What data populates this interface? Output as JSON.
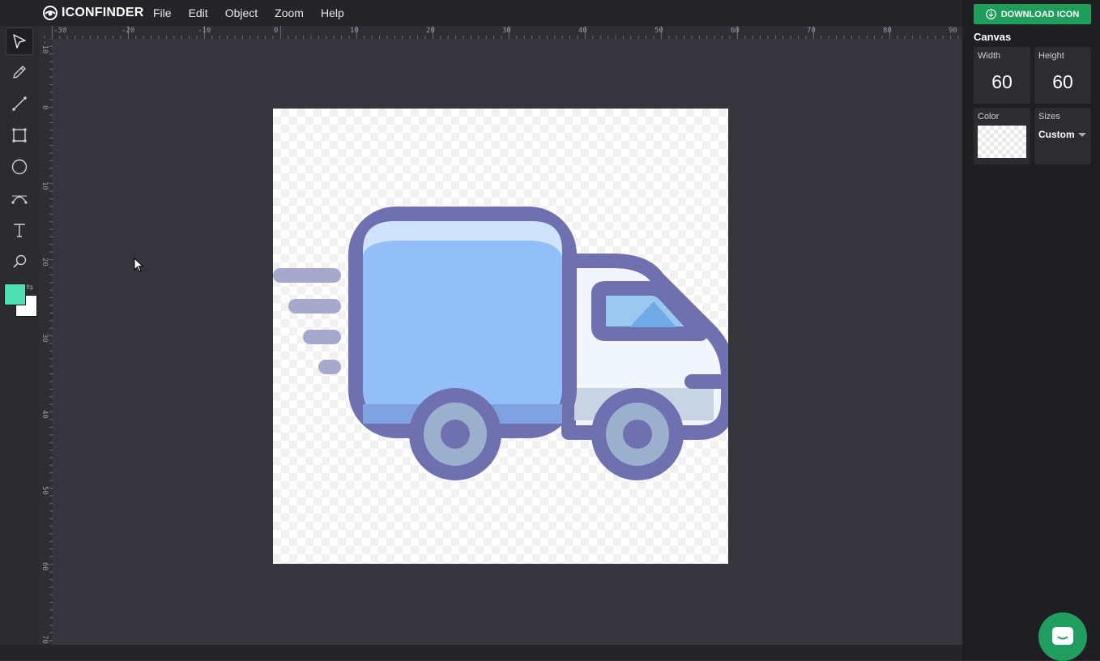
{
  "app": {
    "logo_text": "ICONFINDER",
    "menu": [
      {
        "label": "File"
      },
      {
        "label": "Edit"
      },
      {
        "label": "Object"
      },
      {
        "label": "Zoom"
      },
      {
        "label": "Help"
      }
    ]
  },
  "tools": [
    {
      "name": "select",
      "icon": "cursor-arrow-icon",
      "active": true
    },
    {
      "name": "pencil",
      "icon": "pencil-icon",
      "active": false
    },
    {
      "name": "line",
      "icon": "line-icon",
      "active": false
    },
    {
      "name": "rectangle",
      "icon": "rectangle-icon",
      "active": false
    },
    {
      "name": "ellipse",
      "icon": "ellipse-icon",
      "active": false
    },
    {
      "name": "curve",
      "icon": "bezier-curve-icon",
      "active": false
    },
    {
      "name": "text",
      "icon": "text-icon",
      "active": false
    },
    {
      "name": "zoom",
      "icon": "magnifier-icon",
      "active": false
    }
  ],
  "colors": {
    "foreground": "#4ee0b0",
    "background": "#ffffff",
    "accent": "#1e9e5a"
  },
  "rulers": {
    "horizontal_labels": [
      "-30",
      "-20",
      "-10",
      "0",
      "10",
      "20",
      "30",
      "40",
      "50",
      "60",
      "70",
      "80",
      "90"
    ],
    "vertical_labels": [
      "-10",
      "0",
      "10",
      "20",
      "30",
      "40",
      "50",
      "60",
      "70"
    ]
  },
  "panel": {
    "download_label": "DOWNLOAD ICON",
    "canvas_title": "Canvas",
    "width_label": "Width",
    "width_value": "60",
    "height_label": "Height",
    "height_value": "60",
    "color_label": "Color",
    "sizes_label": "Sizes",
    "sizes_value": "Custom"
  }
}
